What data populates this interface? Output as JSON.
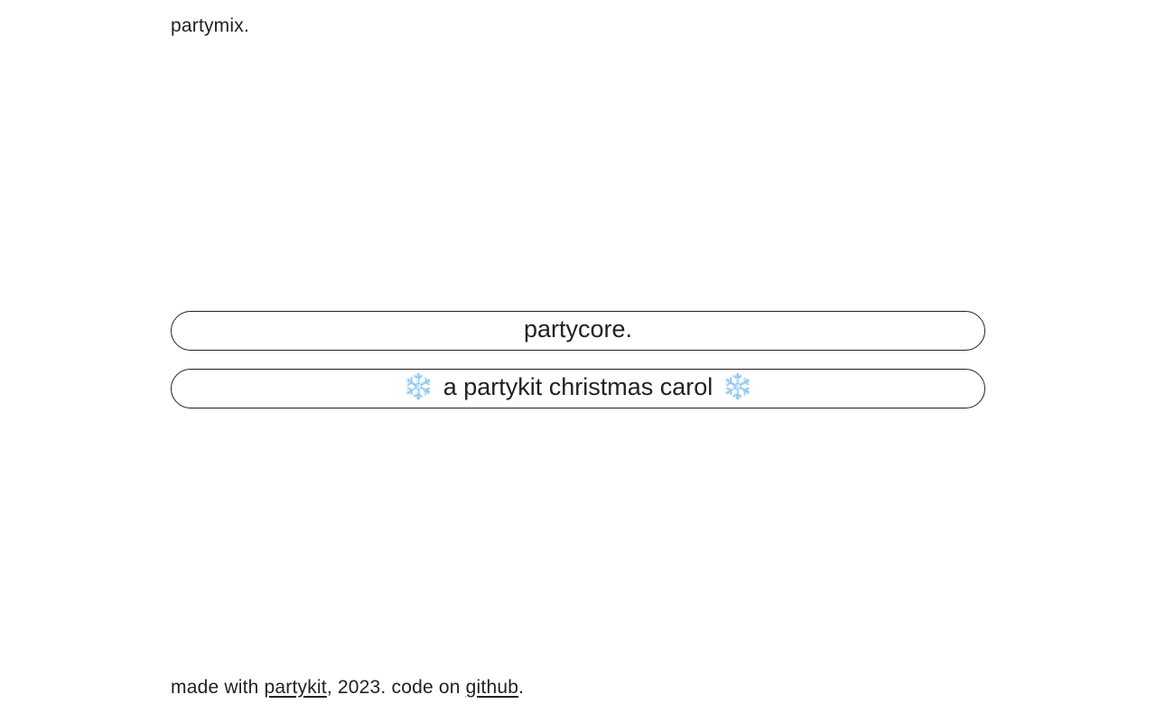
{
  "header": {
    "brand": "partymix."
  },
  "mixes": [
    {
      "label": "partycore."
    },
    {
      "label": "a partykit christmas carol",
      "icon_left": "❄️",
      "icon_right": "❄️"
    }
  ],
  "footer": {
    "prefix": "made with ",
    "link1": "partykit",
    "middle": ", 2023. code on ",
    "link2": "github",
    "suffix": "."
  },
  "colors": {
    "text": "#222222",
    "background": "#ffffff",
    "snowflake": "#7db9e8"
  },
  "icons": {
    "snowflake": "snowflake-icon"
  }
}
